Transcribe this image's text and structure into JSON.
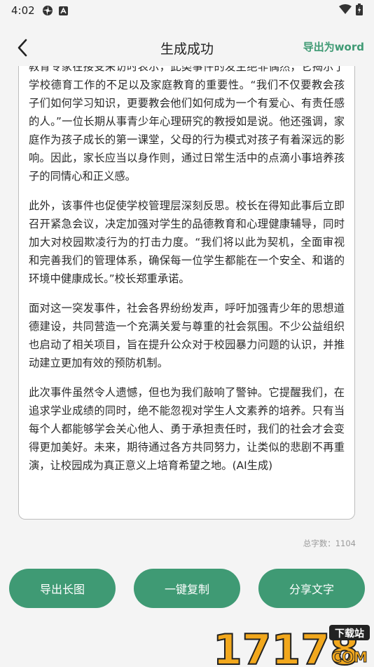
{
  "status": {
    "time": "4:02"
  },
  "header": {
    "title": "生成成功",
    "export_word": "导出为word"
  },
  "content": {
    "paragraphs": [
      "教育专家在接受采访时表示，此类事件的发生绝非偶然，它揭示了学校德育工作的不足以及家庭教育的重要性。“我们不仅要教会孩子们如何学习知识，更要教会他们如何成为一个有爱心、有责任感的人。”一位长期从事青少年心理研究的教授如是说。他还强调，家庭作为孩子成长的第一课堂，父母的行为模式对孩子有着深远的影响。因此，家长应当以身作则，通过日常生活中的点滴小事培养孩子的同情心和正义感。",
      "此外，该事件也促使学校管理层深刻反思。校长在得知此事后立即召开紧急会议，决定加强对学生的品德教育和心理健康辅导，同时加大对校园欺凌行为的打击力度。“我们将以此为契机，全面审视和完善我们的管理体系，确保每一位学生都能在一个安全、和谐的环境中健康成长。”校长郑重承诺。",
      "面对这一突发事件，社会各界纷纷发声，呼吁加强青少年的思想道德建设，共同营造一个充满关爱与尊重的社会氛围。不少公益组织也启动了相关项目，旨在提升公众对于校园暴力问题的认识，并推动建立更加有效的预防机制。",
      "此次事件虽然令人遗憾，但也为我们敲响了警钟。它提醒我们，在追求学业成绩的同时，绝不能忽视对学生人文素养的培养。只有当每个人都能够学会关心他人、勇于承担责任时，我们的社会才会变得更加美好。未来，期待通过各方共同努力，让类似的悲剧不再重演，让校园成为真正意义上培育希望之地。(AI生成)"
    ]
  },
  "word_count": "总字数：1104",
  "buttons": {
    "export_long": "导出长图",
    "copy": "一键复制",
    "share": "分享文字"
  },
  "watermark": {
    "number": "17178",
    "tag": "下载站",
    "domain": "COM"
  },
  "colors": {
    "accent": "#3f9a74",
    "watermark_orange": "#f2a81d"
  }
}
